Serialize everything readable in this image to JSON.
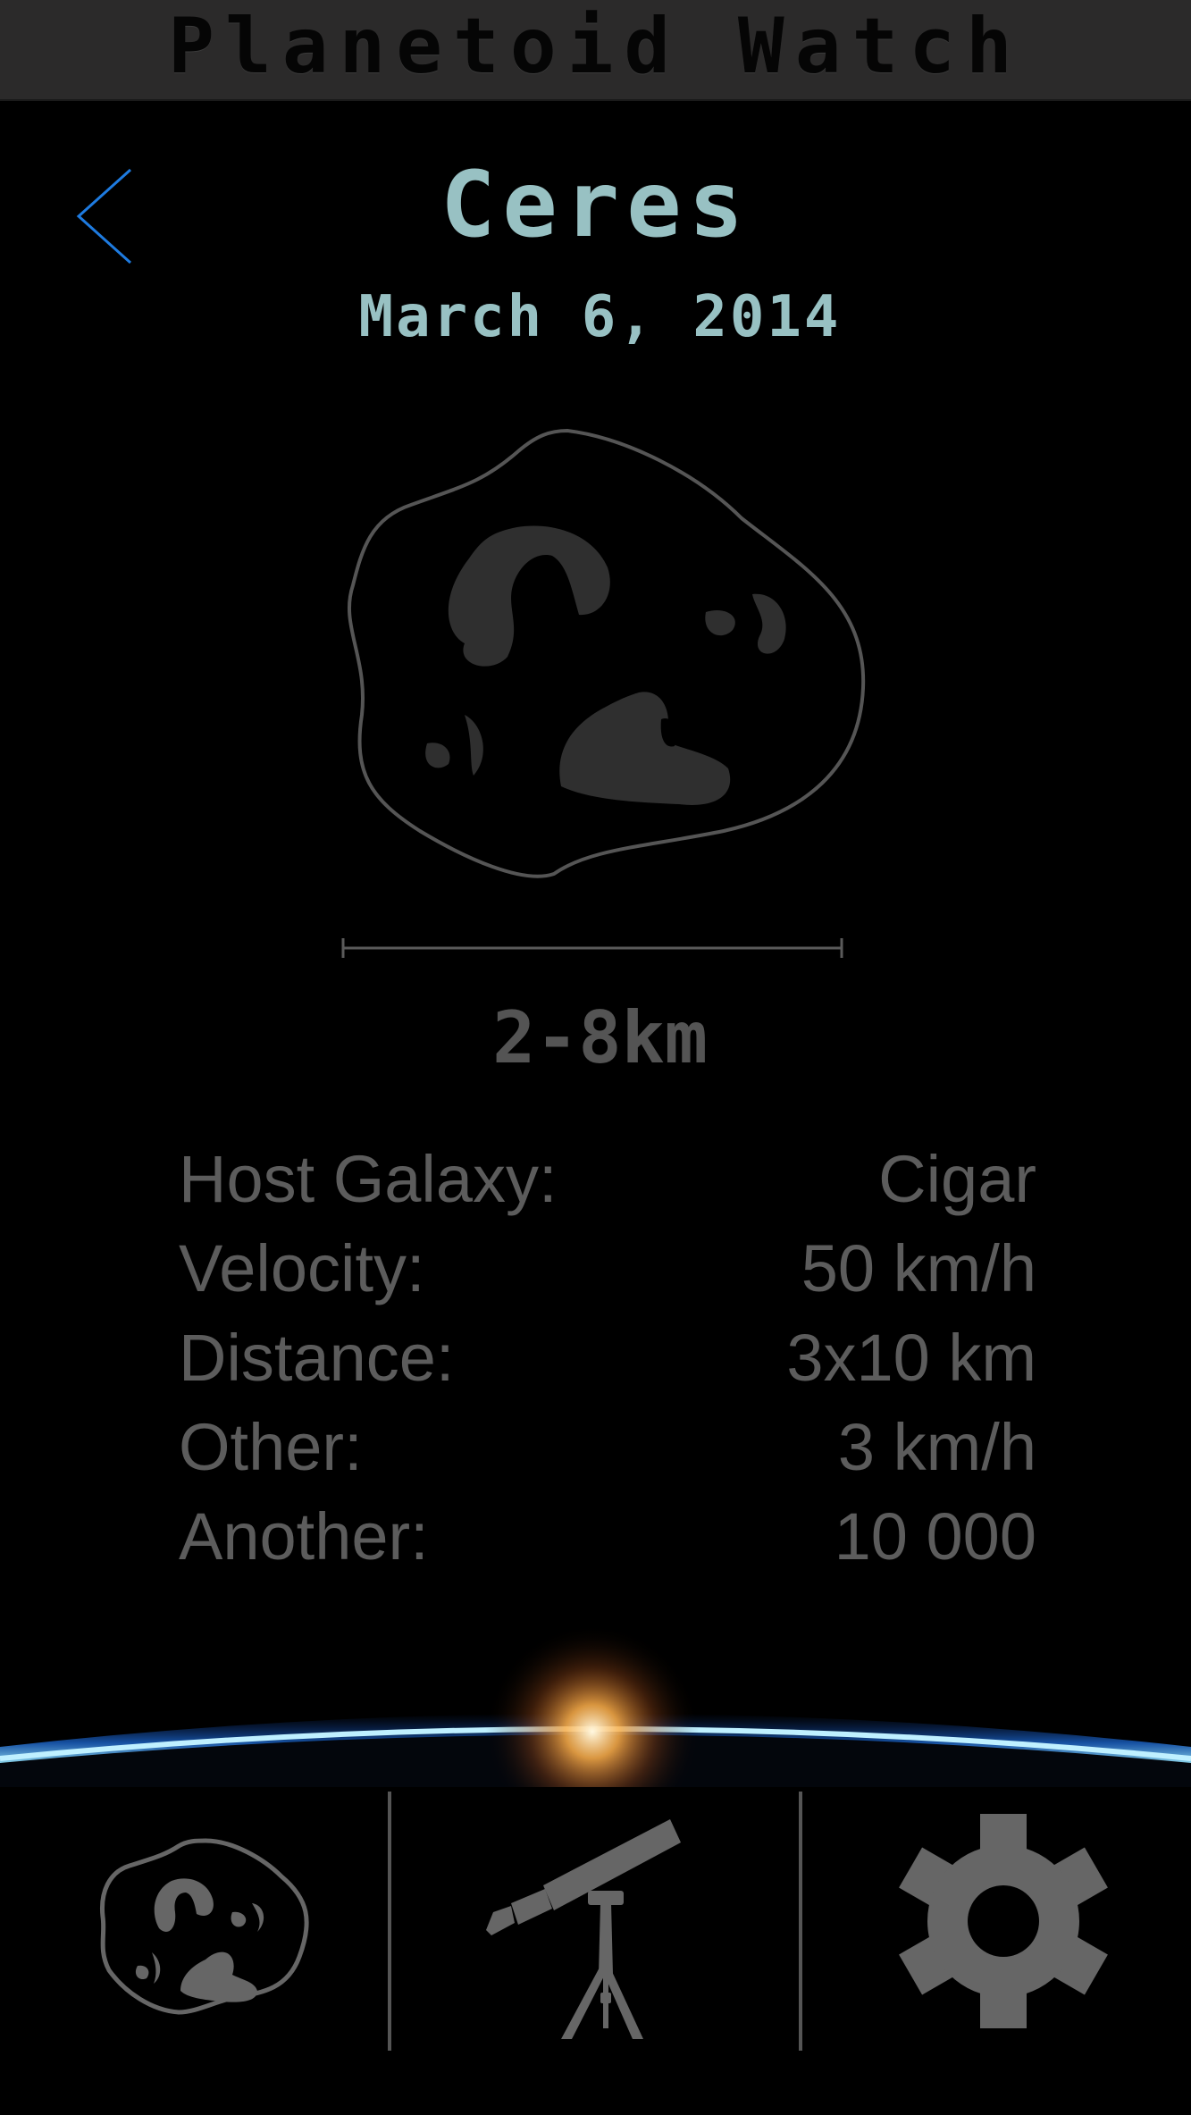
{
  "header": {
    "app_title": "Planetoid Watch"
  },
  "asteroid": {
    "name": "Ceres",
    "date": "March 6, 2014",
    "size_label": "2-8km"
  },
  "details": [
    {
      "label": "Host Galaxy:",
      "value": "Cigar"
    },
    {
      "label": "Velocity:",
      "value": "50 km/h"
    },
    {
      "label": "Distance:",
      "value": "3x10 km"
    },
    {
      "label": "Other:",
      "value": "3 km/h"
    },
    {
      "label": "Another:",
      "value": "10 000"
    }
  ],
  "tabs": [
    {
      "name": "asteroids",
      "icon": "asteroid-icon"
    },
    {
      "name": "observe",
      "icon": "telescope-icon"
    },
    {
      "name": "settings",
      "icon": "gear-icon"
    }
  ],
  "colors": {
    "accent": "#98c1c3",
    "back_arrow": "#1e7be0",
    "muted": "#5c5c5c",
    "header_bg": "#2b2a2a"
  }
}
